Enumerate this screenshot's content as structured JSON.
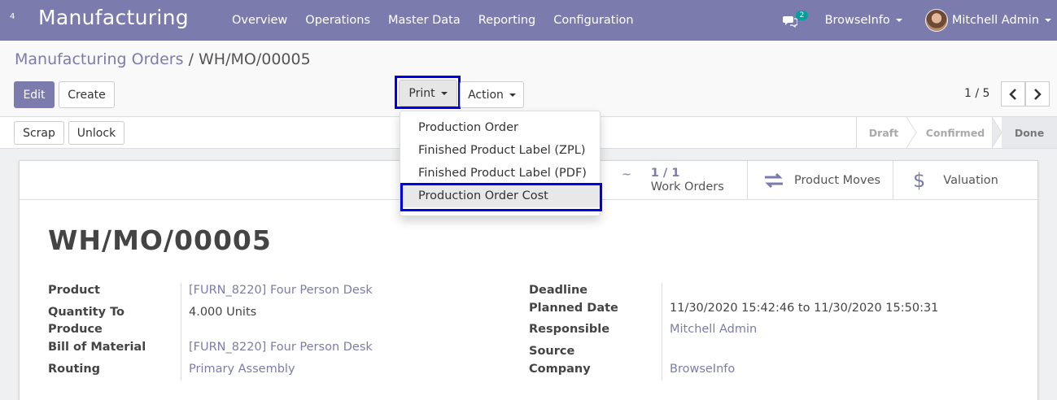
{
  "navbar": {
    "apps_badge": "4",
    "brand": "Manufacturing",
    "menu": [
      "Overview",
      "Operations",
      "Master Data",
      "Reporting",
      "Configuration"
    ],
    "chat_count": "2",
    "company": "BrowseInfo",
    "user": "Mitchell Admin"
  },
  "breadcrumb": {
    "parent": "Manufacturing Orders",
    "separator": "/",
    "current": "WH/MO/00005"
  },
  "buttons": {
    "edit": "Edit",
    "create": "Create",
    "print": "Print",
    "action": "Action",
    "scrap": "Scrap",
    "unlock": "Unlock"
  },
  "pager": {
    "value": "1 / 5"
  },
  "stages": [
    "Draft",
    "Confirmed",
    "Done"
  ],
  "print_menu": [
    "Production Order",
    "Finished Product Label (ZPL)",
    "Finished Product Label (PDF)",
    "Production Order Cost"
  ],
  "smart_buttons": {
    "work_orders_count": "1 / 1",
    "work_orders_label": "Work Orders",
    "product_moves": "Product Moves",
    "valuation": "Valuation"
  },
  "record": {
    "name": "WH/MO/00005",
    "left_fields": {
      "product_label": "Product",
      "product_value": "[FURN_8220] Four Person Desk",
      "qty_label_1": "Quantity To",
      "qty_label_2": "Produce",
      "qty_value": "4.000 Units",
      "bom_label": "Bill of Material",
      "bom_value": "[FURN_8220] Four Person Desk",
      "routing_label": "Routing",
      "routing_value": "Primary Assembly"
    },
    "right_fields": {
      "deadline_label": "Deadline",
      "planned_label": "Planned Date",
      "planned_start": "11/30/2020 15:42:46",
      "planned_to": "to",
      "planned_end": "11/30/2020 15:50:31",
      "responsible_label": "Responsible",
      "responsible_value": "Mitchell Admin",
      "source_label": "Source",
      "company_label": "Company",
      "company_value": "BrowseInfo"
    }
  },
  "colors": {
    "navbar": "#7c7bad",
    "highlight": "#0000e6",
    "accent": "#00a09d"
  }
}
